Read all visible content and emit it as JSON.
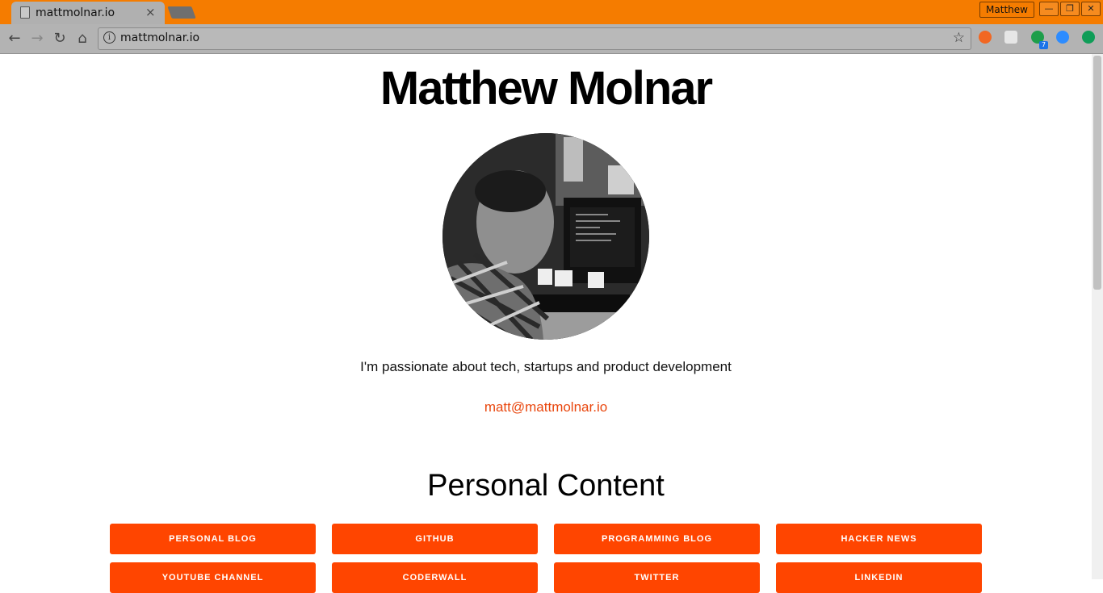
{
  "browser": {
    "tab_title": "mattmolnar.io",
    "tab_close": "×",
    "profile": "Matthew",
    "url": "mattmolnar.io",
    "extension_badge": "7",
    "accent": "#f57c00"
  },
  "page": {
    "name": "Matthew Molnar",
    "tagline": "I'm passionate about tech, startups and product development",
    "email": "matt@mattmolnar.io",
    "section_title": "Personal Content",
    "buttons": [
      "PERSONAL BLOG",
      "GITHUB",
      "PROGRAMMING BLOG",
      "HACKER NEWS",
      "YOUTUBE CHANNEL",
      "CODERWALL",
      "TWITTER",
      "LINKEDIN"
    ],
    "button_color": "#ff4500",
    "link_color": "#e9460d"
  }
}
